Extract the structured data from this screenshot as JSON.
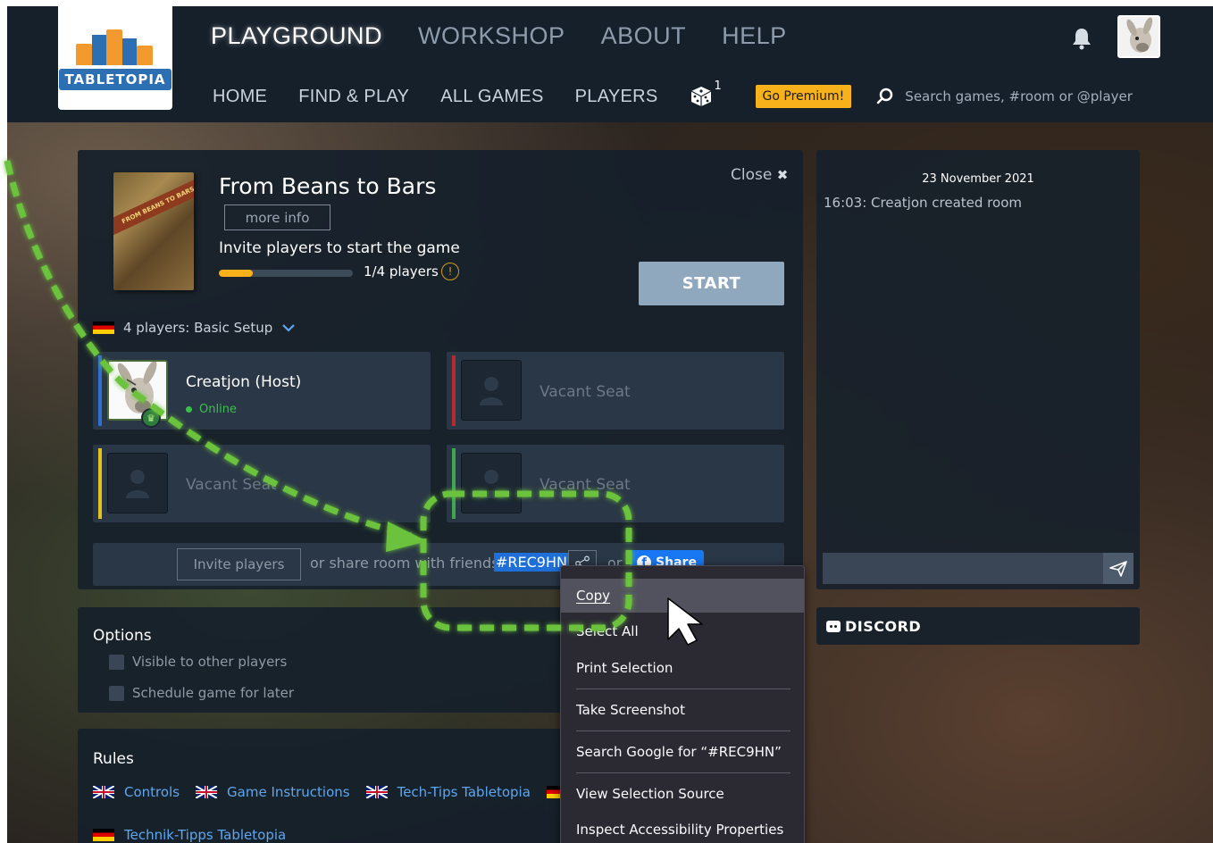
{
  "logo": {
    "text": "TABLETOPIA"
  },
  "topnav": {
    "items": [
      "PLAYGROUND",
      "WORKSHOP",
      "ABOUT",
      "HELP"
    ],
    "active": "PLAYGROUND"
  },
  "subnav": {
    "items": [
      "HOME",
      "FIND & PLAY",
      "ALL GAMES",
      "PLAYERS"
    ],
    "dice_badge": "1",
    "premium": "Go Premium!",
    "search_placeholder": "Search games, #room or @player"
  },
  "room": {
    "game_title": "From Beans to Bars",
    "box_art_text": "FROM BEANS TO BARS",
    "more_info": "more info",
    "close": "Close",
    "close_icon": "✖",
    "invite_text": "Invite players to start the game",
    "players_count": "1/4 players",
    "players_fraction": 0.25,
    "warning_icon": "!",
    "start": "START",
    "setup": "4 players: Basic Setup",
    "seats": [
      {
        "name": "Creatjon (Host)",
        "status": "Online",
        "color": "#2f6fd1"
      },
      {
        "name": "Vacant Seat",
        "color": "#b8292d"
      },
      {
        "name": "Vacant Seat",
        "color": "#e4c21d"
      },
      {
        "name": "Vacant Seat",
        "color": "#3ea84a"
      }
    ],
    "invite_players": "Invite players",
    "share_text": "or share room with friends",
    "room_code": "#REC9HN",
    "or": "or",
    "fb_share": "Share"
  },
  "options": {
    "title": "Options",
    "items": [
      "Visible to other players",
      "Schedule game for later"
    ]
  },
  "rules": {
    "title": "Rules",
    "links": [
      "Controls",
      "Game Instructions",
      "Tech-Tips Tabletopia",
      "Technik-Tipps Tabletopia"
    ]
  },
  "chat": {
    "date": "23 November 2021",
    "messages": [
      "16:03: Creatjon created room"
    ]
  },
  "discord": {
    "label": "DISCORD"
  },
  "context_menu": {
    "items": [
      "Copy",
      "Select All",
      "Print Selection",
      "Take Screenshot",
      "Search Google for “#REC9HN”",
      "View Selection Source",
      "Inspect Accessibility Properties"
    ]
  },
  "colors": {
    "header_bg": "#16202b",
    "panel_bg": "#16202b",
    "accent_yellow": "#f7b21b",
    "link_blue": "#5ea6ef",
    "online_green": "#39c04a",
    "annotation_green": "#6bc23c"
  }
}
